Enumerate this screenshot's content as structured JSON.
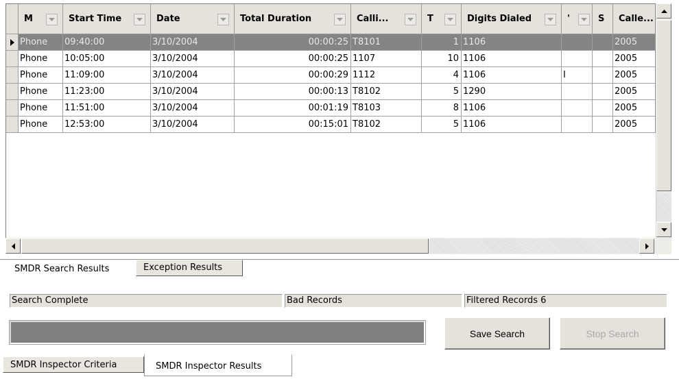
{
  "grid": {
    "columns": [
      {
        "label": "M",
        "has_filter": true
      },
      {
        "label": "Start Time",
        "has_filter": true
      },
      {
        "label": "Date",
        "has_filter": true
      },
      {
        "label": "Total Duration",
        "has_filter": true
      },
      {
        "label": "Calli...",
        "has_filter": true
      },
      {
        "label": "T",
        "has_filter": true
      },
      {
        "label": "Digits Dialed",
        "has_filter": true
      },
      {
        "label": "'",
        "has_filter": true
      },
      {
        "label": "S",
        "has_filter": false
      },
      {
        "label": "Calle...",
        "has_filter": false
      }
    ],
    "rows": [
      {
        "selected": true,
        "cells": [
          "Phone",
          "09:40:00",
          "3/10/2004",
          "00:00:25",
          "T8101",
          "1",
          "1106",
          "",
          "",
          "2005"
        ]
      },
      {
        "selected": false,
        "cells": [
          "Phone",
          "10:05:00",
          "3/10/2004",
          "00:00:25",
          "1107",
          "10",
          "1106",
          "",
          "",
          "2005"
        ]
      },
      {
        "selected": false,
        "cells": [
          "Phone",
          "11:09:00",
          "3/10/2004",
          "00:00:29",
          "1112",
          "4",
          "1106",
          "I",
          "",
          "2005"
        ]
      },
      {
        "selected": false,
        "cells": [
          "Phone",
          "11:23:00",
          "3/10/2004",
          "00:00:13",
          "T8102",
          "5",
          "1290",
          "",
          "",
          "2005"
        ]
      },
      {
        "selected": false,
        "cells": [
          "Phone",
          "11:51:00",
          "3/10/2004",
          "00:01:19",
          "T8103",
          "8",
          "1106",
          "",
          "",
          "2005"
        ]
      },
      {
        "selected": false,
        "cells": [
          "Phone",
          "12:53:00",
          "3/10/2004",
          "00:15:01",
          "T8102",
          "5",
          "1106",
          "",
          "",
          "2005"
        ]
      }
    ]
  },
  "inner_tabs": {
    "search_results": "SMDR Search Results",
    "exception_results": "Exception Results"
  },
  "status": {
    "search_state": "Search Complete",
    "bad_records": "Bad Records",
    "filtered_records": "Filtered Records 6"
  },
  "buttons": {
    "save_search": "Save Search",
    "stop_search": "Stop Search"
  },
  "outer_tabs": {
    "criteria": "SMDR Inspector Criteria",
    "results": "SMDR Inspector Results"
  }
}
